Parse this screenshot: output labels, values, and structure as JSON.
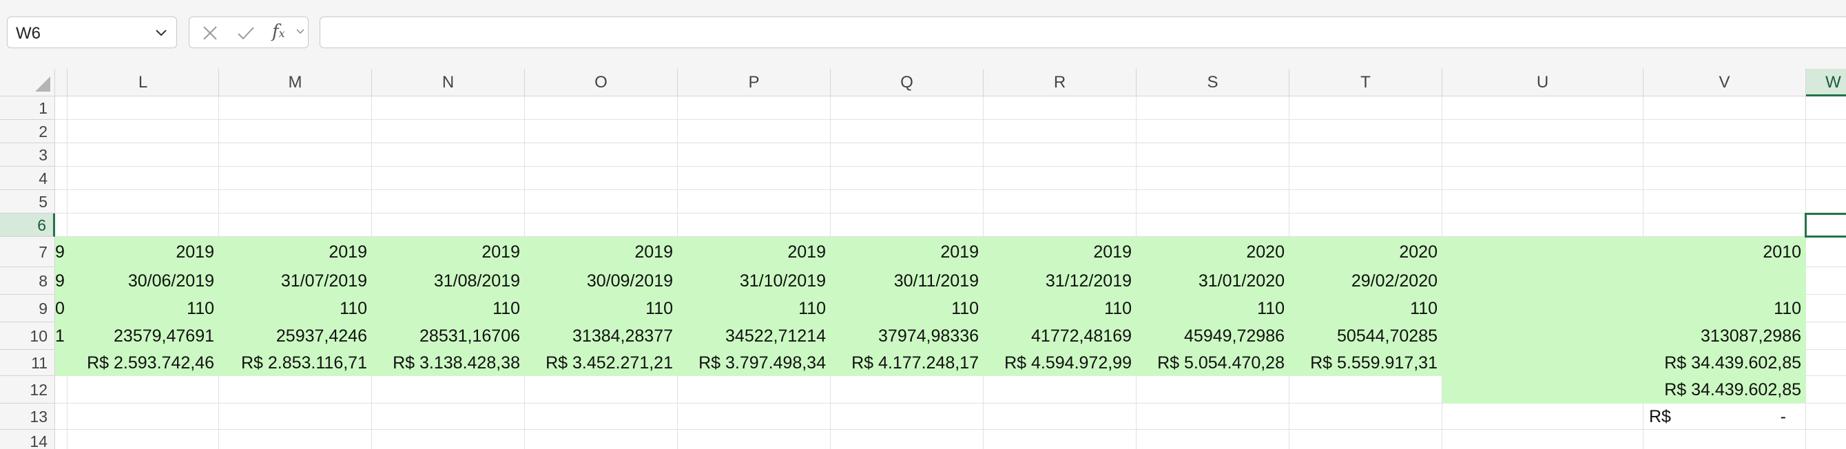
{
  "name_box": {
    "value": "W6"
  },
  "formula_bar": {
    "fx_label": "f",
    "fx_sub": "x",
    "content": ""
  },
  "columns": [
    "",
    "L",
    "M",
    "N",
    "O",
    "P",
    "Q",
    "R",
    "S",
    "T",
    "U",
    "V",
    "W"
  ],
  "rows": [
    "1",
    "2",
    "3",
    "4",
    "5",
    "6",
    "7",
    "8",
    "9",
    "10",
    "11",
    "12",
    "13",
    "14"
  ],
  "active_cell": "W6",
  "cells": {
    "r7": [
      "9",
      "2019",
      "2019",
      "2019",
      "2019",
      "2019",
      "2019",
      "2019",
      "2020",
      "2020",
      "",
      "2010"
    ],
    "r8": [
      "9",
      "30/06/2019",
      "31/07/2019",
      "31/08/2019",
      "30/09/2019",
      "31/10/2019",
      "30/11/2019",
      "31/12/2019",
      "31/01/2020",
      "29/02/2020",
      "",
      ""
    ],
    "r9": [
      "0",
      "110",
      "110",
      "110",
      "110",
      "110",
      "110",
      "110",
      "110",
      "110",
      "",
      "110"
    ],
    "r10": [
      "1",
      "23579,47691",
      "25937,4246",
      "28531,16706",
      "31384,28377",
      "34522,71214",
      "37974,98336",
      "41772,48169",
      "45949,72986",
      "50544,70285",
      "",
      "313087,2986"
    ],
    "r11": [
      "",
      "R$ 2.593.742,46",
      "R$ 2.853.116,71",
      "R$ 3.138.428,38",
      "R$ 3.452.271,21",
      "R$ 3.797.498,34",
      "R$ 4.177.248,17",
      "R$ 4.594.972,99",
      "R$ 5.054.470,28",
      "R$ 5.559.917,31",
      "",
      "R$ 34.439.602,85"
    ],
    "r12": [
      "",
      "",
      "",
      "",
      "",
      "",
      "",
      "",
      "",
      "",
      "",
      "R$ 34.439.602,85"
    ],
    "r13": [
      "",
      "",
      "",
      "",
      "",
      "",
      "",
      "",
      "",
      "",
      "",
      "R$"
    ],
    "r13_dash": "-"
  },
  "colors": {
    "fill_green": "#ccf9c3",
    "accent": "#217346"
  }
}
